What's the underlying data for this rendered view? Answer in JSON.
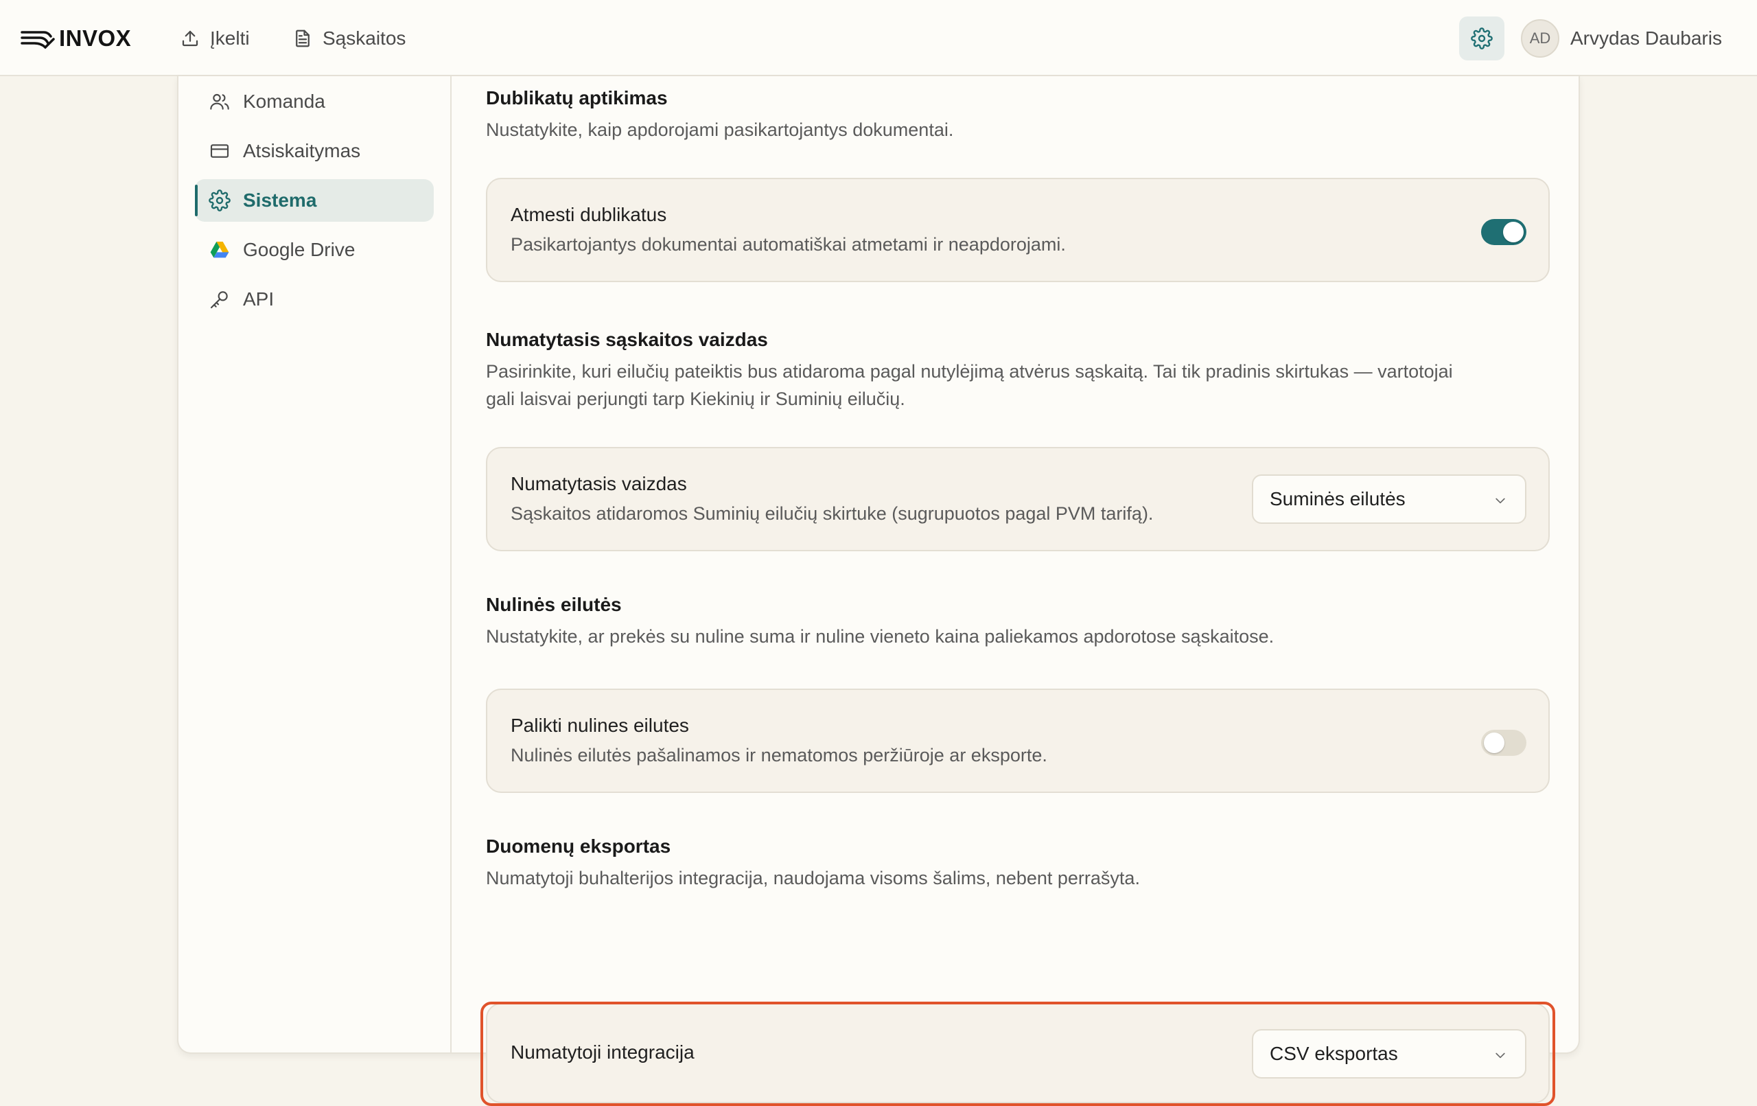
{
  "header": {
    "logo_text": "INVOX",
    "nav": [
      {
        "label": "Įkelti",
        "icon": "upload-icon"
      },
      {
        "label": "Sąskaitos",
        "icon": "document-icon"
      }
    ],
    "settings_icon": "gear-icon",
    "user": {
      "initials": "AD",
      "name": "Arvydas Daubaris"
    }
  },
  "sidebar": {
    "items": [
      {
        "label": "Komanda",
        "icon": "users-icon",
        "active": false
      },
      {
        "label": "Atsiskaitymas",
        "icon": "credit-card-icon",
        "active": false
      },
      {
        "label": "Sistema",
        "icon": "gear-icon",
        "active": true
      },
      {
        "label": "Google Drive",
        "icon": "google-drive-icon",
        "active": false
      },
      {
        "label": "API",
        "icon": "key-icon",
        "active": false
      }
    ]
  },
  "sections": {
    "duplicates": {
      "title": "Dublikatų aptikimas",
      "description": "Nustatykite, kaip apdorojami pasikartojantys dokumentai.",
      "setting": {
        "title": "Atmesti dublikatus",
        "description": "Pasikartojantys dokumentai automatiškai atmetami ir neapdorojami.",
        "enabled": true
      }
    },
    "default_view": {
      "title": "Numatytasis sąskaitos vaizdas",
      "description_line1": "Pasirinkite, kuri eilučių pateiktis bus atidaroma pagal nutylėjimą atvėrus sąskaitą. Tai tik pradinis skirtukas — vartotojai",
      "description_line2": "gali laisvai perjungti tarp Kiekinių ir Suminių eilučių.",
      "setting": {
        "title": "Numatytasis vaizdas",
        "description": "Sąskaitos atidaromos Suminių eilučių skirtuke (sugrupuotos pagal PVM tarifą).",
        "selected": "Suminės eilutės"
      }
    },
    "zero_lines": {
      "title": "Nulinės eilutės",
      "description": "Nustatykite, ar prekės su nuline suma ir nuline vieneto kaina paliekamos apdorotose sąskaitose.",
      "setting": {
        "title": "Palikti nulines eilutes",
        "description": "Nulinės eilutės pašalinamos ir nematomos peržiūroje ar eksporte.",
        "enabled": false
      }
    },
    "export": {
      "title": "Duomenų eksportas",
      "description": "Numatytoji buhalterijos integracija, naudojama visoms šalims, nebent perrašyta.",
      "setting": {
        "title": "Numatytoji integracija",
        "selected": "CSV eksportas"
      }
    }
  },
  "colors": {
    "accent": "#1f6f73",
    "highlight": "#e0532b",
    "background": "#f7f4ec"
  }
}
